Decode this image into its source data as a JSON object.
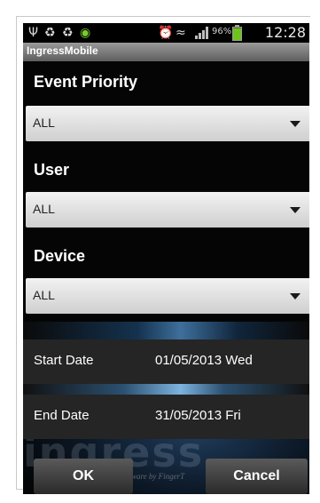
{
  "status_bar": {
    "icons": [
      "usb-icon",
      "recycle-icon",
      "recycle-icon",
      "android-icon",
      "alarm-icon",
      "wifi-icon",
      "signal-icon",
      "battery-icon"
    ],
    "battery_percent": "96%",
    "battery_level": 0.96,
    "time": "12:28"
  },
  "app": {
    "title": "IngressMobile"
  },
  "filters": {
    "event_priority": {
      "label": "Event Priority",
      "value": "ALL"
    },
    "user": {
      "label": "User",
      "value": "ALL"
    },
    "device": {
      "label": "Device",
      "value": "ALL"
    }
  },
  "dates": {
    "start": {
      "label": "Start Date",
      "value": "01/05/2013 Wed"
    },
    "end": {
      "label": "End Date",
      "value": "31/05/2013 Fri"
    }
  },
  "buttons": {
    "ok": "OK",
    "cancel": "Cancel"
  },
  "background": {
    "logo_text": "ingress",
    "tagline": "ware by FingerT"
  },
  "colors": {
    "battery_green": "#6ec31c",
    "screen_bg": "#050505",
    "row_bg": "#252525"
  }
}
